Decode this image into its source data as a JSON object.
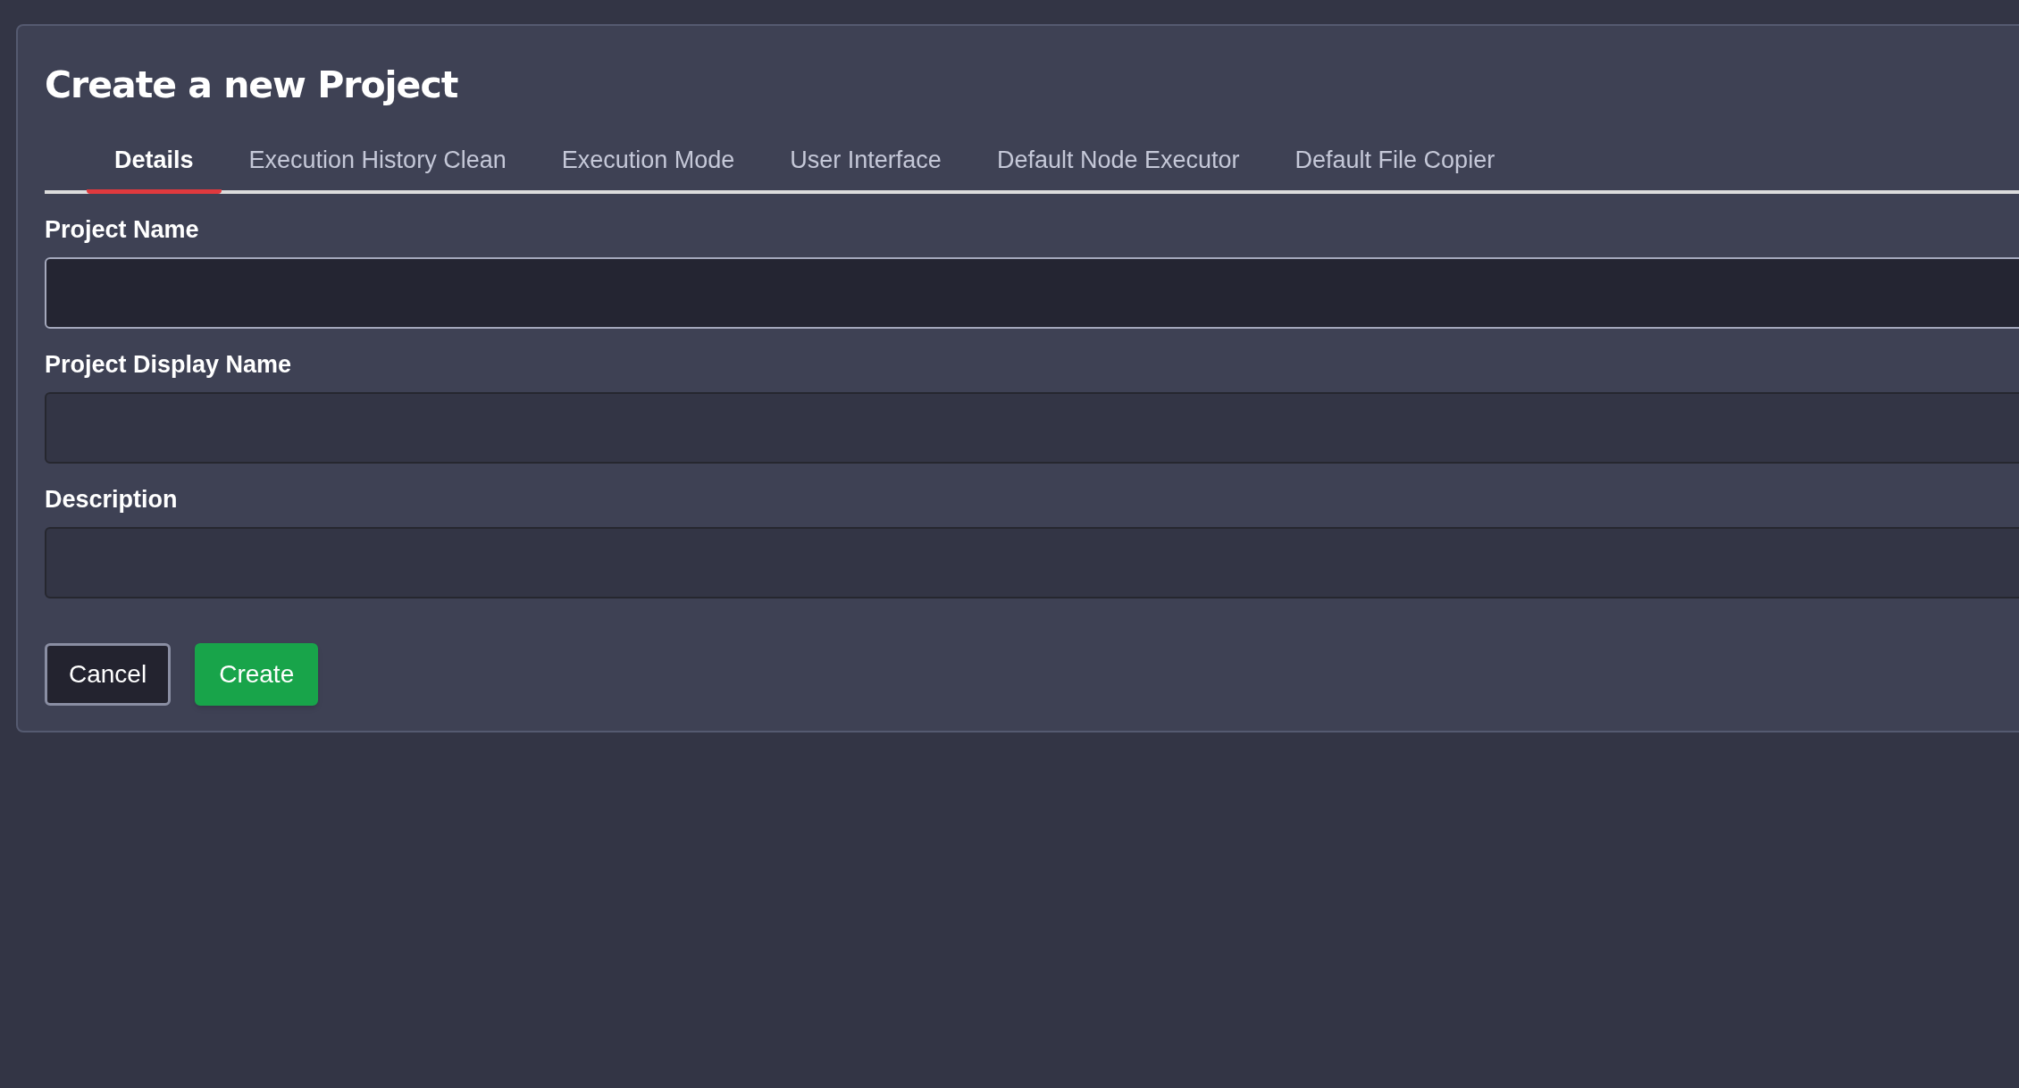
{
  "dialog": {
    "title": "Create a new Project"
  },
  "tabs": [
    {
      "label": "Details",
      "selected": true
    },
    {
      "label": "Execution History Clean",
      "selected": false
    },
    {
      "label": "Execution Mode",
      "selected": false
    },
    {
      "label": "User Interface",
      "selected": false
    },
    {
      "label": "Default Node Executor",
      "selected": false
    },
    {
      "label": "Default File Copier",
      "selected": false
    }
  ],
  "fields": [
    {
      "label": "Project Name",
      "focused": true
    },
    {
      "label": "Project Display Name",
      "focused": false
    },
    {
      "label": "Description",
      "focused": false
    }
  ],
  "buttons": [
    {
      "label": "Cancel",
      "kind": "secondary"
    },
    {
      "label": "Create",
      "kind": "primary"
    }
  ]
}
